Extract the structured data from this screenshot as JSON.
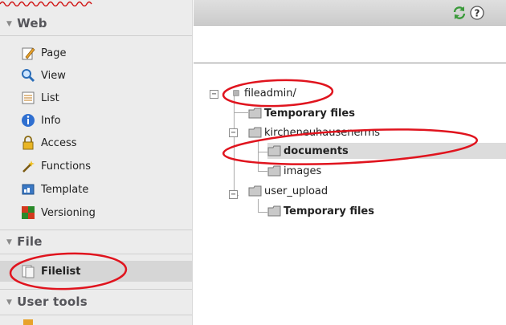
{
  "sidebar": {
    "sections": [
      {
        "title": "Web",
        "items": [
          {
            "label": "Page",
            "icon": "page-edit-icon"
          },
          {
            "label": "View",
            "icon": "magnifier-icon"
          },
          {
            "label": "List",
            "icon": "list-icon"
          },
          {
            "label": "Info",
            "icon": "info-icon"
          },
          {
            "label": "Access",
            "icon": "lock-icon"
          },
          {
            "label": "Functions",
            "icon": "wand-icon"
          },
          {
            "label": "Template",
            "icon": "template-icon"
          },
          {
            "label": "Versioning",
            "icon": "versioning-icon"
          }
        ]
      },
      {
        "title": "File",
        "items": [
          {
            "label": "Filelist",
            "icon": "filelist-icon",
            "active": true
          }
        ]
      },
      {
        "title": "User tools",
        "items": []
      }
    ]
  },
  "toolbar": {
    "icons": [
      "refresh-icon",
      "help-icon"
    ]
  },
  "tree": {
    "root": "fileadmin/",
    "nodes": [
      {
        "label": "Temporary files",
        "bold": true
      },
      {
        "label": "kircheneuhausenerms",
        "bold": false
      },
      {
        "label": "documents",
        "bold": true,
        "selected": true
      },
      {
        "label": "images",
        "bold": false
      },
      {
        "label": "user_upload",
        "bold": false
      },
      {
        "label": "Temporary files",
        "bold": true
      }
    ]
  },
  "annotation": {
    "highlight_color": "#e0141e"
  }
}
